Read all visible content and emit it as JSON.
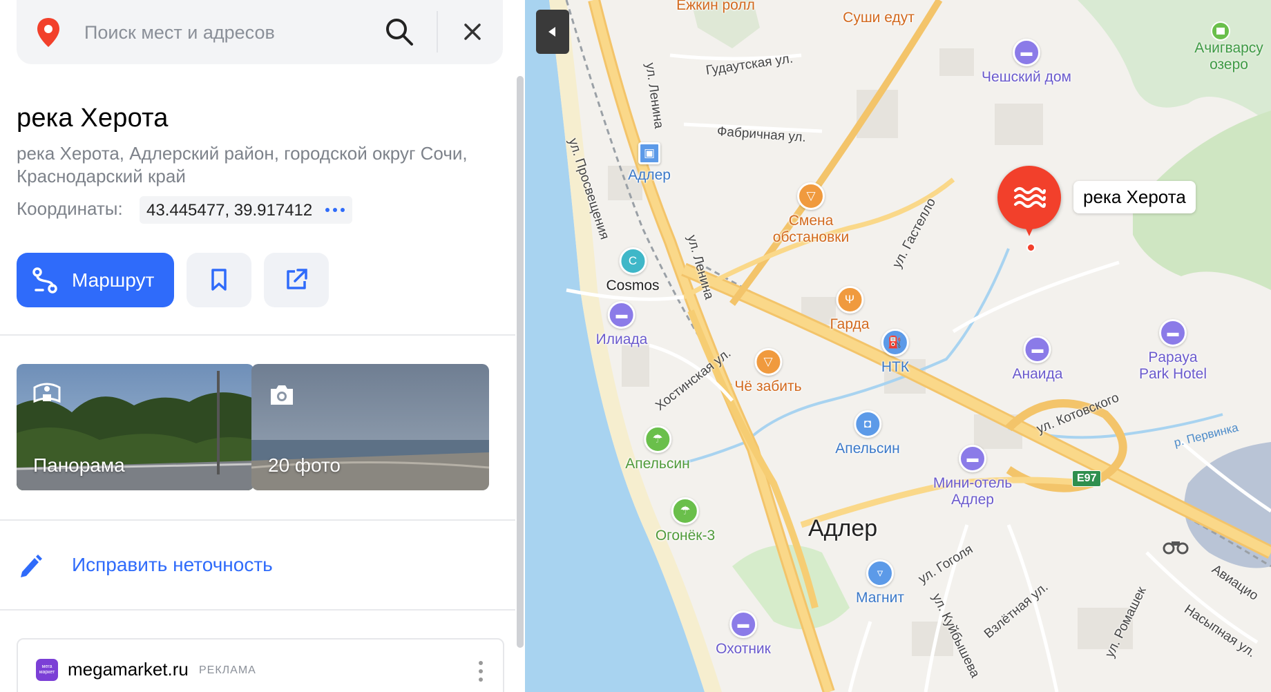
{
  "search": {
    "placeholder": "Поиск мест и адресов"
  },
  "place": {
    "title": "река Херота",
    "address": "река Херота, Адлерский район, городской округ Сочи, Краснодарский край",
    "coords_label": "Координаты:",
    "coords_value": "43.445477, 39.917412"
  },
  "actions": {
    "route_label": "Маршрут"
  },
  "media": {
    "panorama_label": "Панорама",
    "photos_label": "20 фото"
  },
  "fix": {
    "label": "Исправить неточность"
  },
  "ad": {
    "logo_text": "мега маркет",
    "domain": "megamarket.ru",
    "tag": "РЕКЛАМА"
  },
  "map": {
    "selected_label": "река Херота",
    "city": "Адлер",
    "highway_badge": "E97",
    "lake": "Ачигварсу озеро",
    "pois": {
      "ezhkin": "Ежкин ролл",
      "sushi": "Суши едут",
      "cheshsky": "Чешский дом",
      "adler_station": "Адлер",
      "smena": "Смена обстановки",
      "cosmos": "Cosmos",
      "garda": "Гарда",
      "iliada": "Илиада",
      "ntk": "НТК",
      "anaida": "Анаида",
      "papaya": "Papaya Park Hotel",
      "che_zabit": "Чё забить",
      "apelsin_shop": "Апельсин",
      "apelsin_beach": "Апельсин",
      "mini_hotel": "Мини-отель Адлер",
      "ogonek": "Огонёк-3",
      "magnit": "Магнит",
      "okhotnik": "Охотник"
    },
    "streets": {
      "lenina1": "ул. Ленина",
      "lenina2": "ул. Ленина",
      "gudautskaya": "Гудаутская ул.",
      "fabrichnaya": "Фабричная ул.",
      "prosvescheniya": "ул. Просвещения",
      "gastello": "ул. Гастелло",
      "khostinskaya": "Хостинская ул.",
      "kotovskogo": "ул. Котовского",
      "gogolya": "ул. Гоголя",
      "kuybysheva": "ул. Куйбышева",
      "vzletnaya": "Взлётная ул.",
      "romashek": "ул. Ромашек",
      "nasypnaya": "Насыпная ул.",
      "aviats": "Авиацио",
      "pervinka": "р. Первинка"
    }
  }
}
